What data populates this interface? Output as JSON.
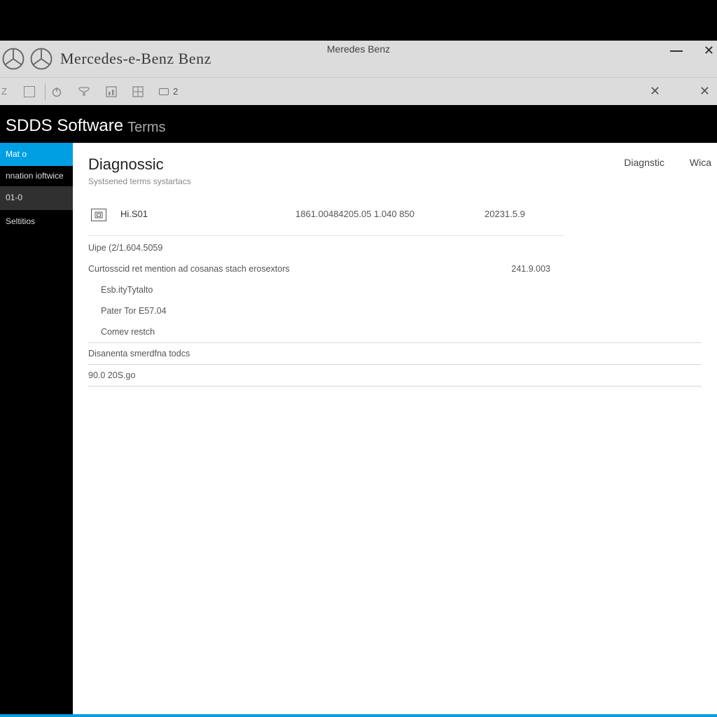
{
  "titlebar": {
    "center": "Meredes Benz",
    "brand": "Mercedes-e-Benz Benz"
  },
  "toolbar": {
    "left_label": "Z",
    "badge_count": "2"
  },
  "section": {
    "title": "SDDS Software",
    "suffix": "Terms"
  },
  "sidebar": {
    "items": [
      {
        "label": "Mat o"
      },
      {
        "label": "nnation ioftwice"
      },
      {
        "label": "01-0"
      },
      {
        "label": "Seltitios"
      }
    ]
  },
  "main": {
    "heading": "Diagnossic",
    "subheading": "Systsened terms systartacs",
    "tabs": {
      "left": "Diagnstic",
      "right": "Wica"
    },
    "row1": {
      "label": "Hi.S01",
      "value": "1861.00484205.05 1.040 850",
      "value2": "20231.5.9"
    },
    "uipe": "Uipe (2/1.604.5059",
    "row2": {
      "label": "Curtosscid ret mention ad cosanas stach erosextors",
      "value": "241.9.003"
    },
    "indent1": "Esb.ityTytalto",
    "indent2": "Pater Tor E57.04",
    "indent3": "Comev restch",
    "row3": "Disanenta smerdfna todcs",
    "row4": "90.0 20S.go"
  }
}
